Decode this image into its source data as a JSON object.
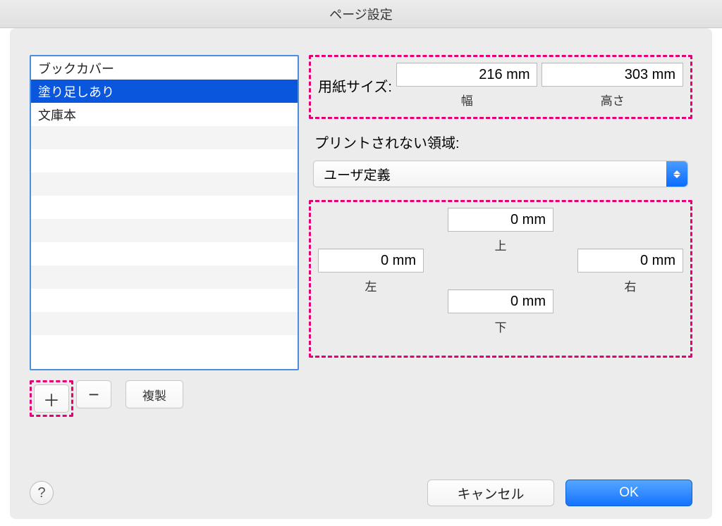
{
  "window": {
    "title": "ページ設定"
  },
  "presets": {
    "items": [
      {
        "label": "ブックカバー",
        "selected": false
      },
      {
        "label": "塗り足しあり",
        "selected": true
      },
      {
        "label": "文庫本",
        "selected": false
      }
    ]
  },
  "toolbar": {
    "add": "＋",
    "remove": "−",
    "duplicate": "複製"
  },
  "paperSize": {
    "label": "用紙サイズ:",
    "width": {
      "value": "216 mm",
      "caption": "幅"
    },
    "height": {
      "value": "303 mm",
      "caption": "高さ"
    }
  },
  "nonPrintable": {
    "label": "プリントされない領域:",
    "dropdownValue": "ユーザ定義",
    "margins": {
      "top": {
        "value": "0 mm",
        "caption": "上"
      },
      "left": {
        "value": "0 mm",
        "caption": "左"
      },
      "right": {
        "value": "0 mm",
        "caption": "右"
      },
      "bottom": {
        "value": "0 mm",
        "caption": "下"
      }
    }
  },
  "buttons": {
    "help": "?",
    "cancel": "キャンセル",
    "ok": "OK"
  }
}
